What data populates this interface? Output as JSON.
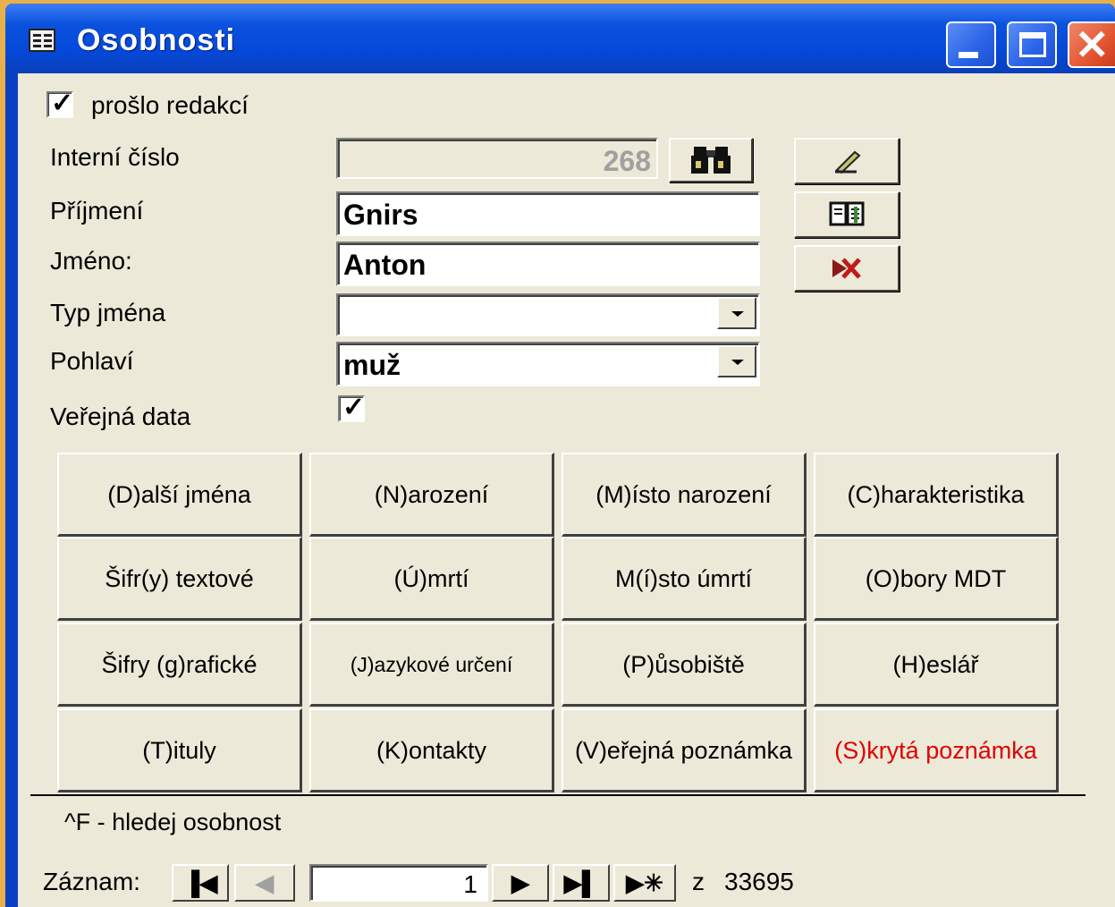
{
  "window": {
    "title": "Osobnosti",
    "controls": {
      "minimize": "minimize",
      "maximize": "maximize",
      "close": "close"
    }
  },
  "form": {
    "proslo_redakci": {
      "label": "prošlo redakcí",
      "checked": true
    },
    "interni_cislo": {
      "label": "Interní číslo",
      "value": "268"
    },
    "prijmeni": {
      "label": "Příjmení",
      "value": "Gnirs"
    },
    "jmeno": {
      "label": "Jméno:",
      "value": "Anton"
    },
    "typ_jmena": {
      "label": "Typ jména",
      "value": ""
    },
    "pohlavi": {
      "label": "Pohlaví",
      "value": "muž"
    },
    "verejna_data": {
      "label": "Veřejná data",
      "checked": true
    }
  },
  "toolbar_icons": [
    "binoculars-icon",
    "pen-icon",
    "book-icon",
    "delete-icon"
  ],
  "grid": [
    [
      "(D)alší jména",
      "(N)arození",
      "(M)ísto narození",
      "(C)harakteristika"
    ],
    [
      "Šifr(y) textové",
      "(Ú)mrtí",
      "M(í)sto úmrtí",
      "(O)bory MDT"
    ],
    [
      "Šifry (g)rafické",
      "(J)azykové určení",
      "(P)ůsobiště",
      "(H)eslář"
    ],
    [
      "(T)ituly",
      "(K)ontakty",
      "(V)eřejná poznámka",
      "(S)krytá poznámka"
    ]
  ],
  "hint": "^F - hledej osobnost",
  "navigator": {
    "label": "Záznam:",
    "current": "1",
    "of_label": "z",
    "total": "33695"
  },
  "colors": {
    "accent": "#0a52de",
    "hidden_note": "#e00000",
    "background": "#ece9d8"
  }
}
